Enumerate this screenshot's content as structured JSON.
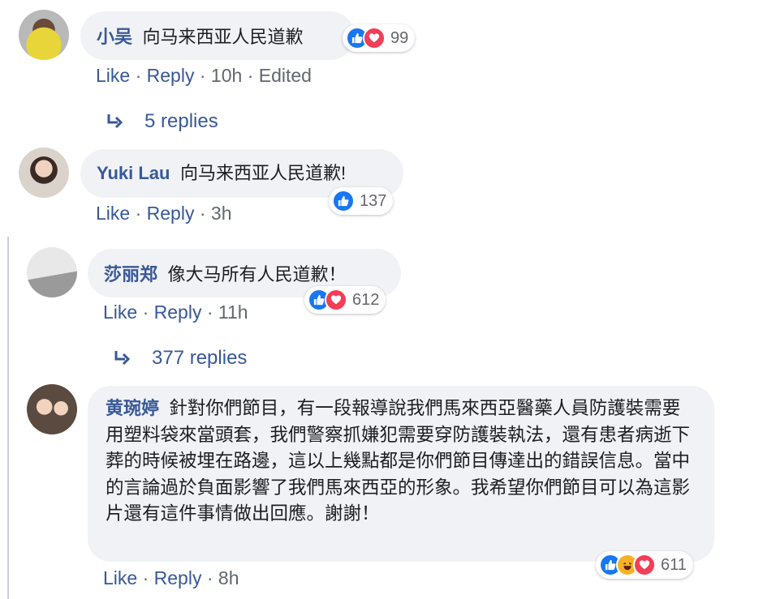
{
  "comments": [
    {
      "author": "小吴",
      "text": "向马来西亚人民道歉",
      "reactions": [
        "like",
        "love"
      ],
      "reaction_count": "99",
      "actions": {
        "like": "Like",
        "reply": "Reply",
        "time": "10h",
        "edited": "Edited"
      }
    },
    {
      "author": "Yuki Lau",
      "text": "向马来西亚人民道歉!",
      "reactions": [
        "like"
      ],
      "reaction_count": "137",
      "actions": {
        "like": "Like",
        "reply": "Reply",
        "time": "3h"
      }
    },
    {
      "author": "莎丽郑",
      "text": "像大马所有人民道歉！",
      "reactions": [
        "like",
        "love"
      ],
      "reaction_count": "612",
      "actions": {
        "like": "Like",
        "reply": "Reply",
        "time": "11h"
      }
    },
    {
      "author": "黄琬婷",
      "text": "針對你們節目，有一段報導說我們馬來西亞醫藥人員防護裝需要用塑料袋來當頭套，我們警察抓嫌犯需要穿防護裝執法，還有患者病逝下葬的時候被埋在路邊，這以上幾點都是你們節目傳達出的錯誤信息。當中的言論過於負面影響了我們馬來西亞的形象。我希望你們節目可以為這影片還有這件事情做出回應。謝謝！",
      "reactions": [
        "like",
        "haha",
        "love"
      ],
      "reaction_count": "611",
      "actions": {
        "like": "Like",
        "reply": "Reply",
        "time": "8h"
      }
    }
  ],
  "reply_links": [
    "5 replies",
    "377 replies"
  ],
  "separator": "·",
  "colors": {
    "link": "#385898",
    "like": "#1877f2",
    "love": "#f33e58",
    "haha": "#f7b125",
    "bubble": "#f0f2f5"
  }
}
